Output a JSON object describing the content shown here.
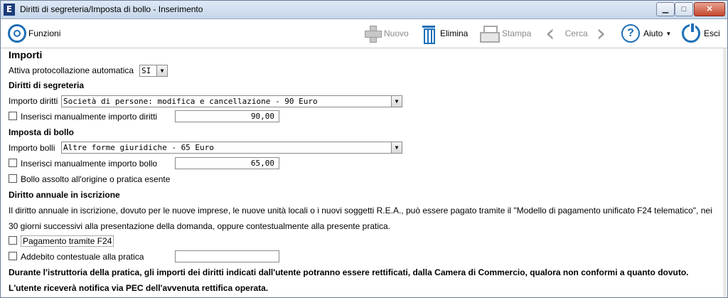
{
  "window": {
    "title": "Diritti di segreteria/Imposta di bollo - Inserimento",
    "app_icon_letter": "E",
    "min_glyph": "▁",
    "max_glyph": "□",
    "close_glyph": "✕"
  },
  "toolbar": {
    "funzioni": "Funzioni",
    "nuovo": "Nuovo",
    "elimina": "Elimina",
    "stampa": "Stampa",
    "prev_glyph": "‹",
    "cerca": "Cerca",
    "next_glyph": "›",
    "help_glyph": "?",
    "aiuto": "Aiuto",
    "caret": "▼",
    "esci": "Esci"
  },
  "form": {
    "section_title": "Importi",
    "protocollazione_label": "Attiva protocollazione automatica",
    "protocollazione_value": "SI",
    "segreteria_title": "Diritti di segreteria",
    "importo_diritti_label": "Importo diritti",
    "importo_diritti_value": "Società di persone: modifica e cancellazione - 90 Euro",
    "manuale_diritti_label": "Inserisci manualmente importo diritti",
    "manuale_diritti_value": "90,00",
    "bollo_title": "Imposta di bollo",
    "importo_bolli_label": "Importo bolli",
    "importo_bolli_value": "Altre forme giuridiche - 65 Euro",
    "manuale_bollo_label": "Inserisci manualmente importo bollo",
    "manuale_bollo_value": "65,00",
    "bollo_assolto_label": "Bollo assolto all'origine o pratica esente",
    "annuale_title": "Diritto annuale in iscrizione",
    "annuale_text_1": "Il diritto annuale in iscrizione, dovuto per le nuove imprese, le nuove unità locali o i nuovi soggetti R.E.A., può essere pagato tramite il \"Modello di pagamento unificato F24 telematico\",  nei",
    "annuale_text_2": "30 giorni successivi alla presentazione della domanda, oppure contestualmente alla presente pratica.",
    "f24_label": "Pagamento tramite F24",
    "addebito_label": "Addebito contestuale alla pratica",
    "addebito_value": "",
    "note_1": "Durante l'istruttoria della pratica, gli importi dei diritti indicati dall'utente potranno essere rettificati, dalla Camera di Commercio, qualora non conformi a quanto dovuto.",
    "note_2": "L'utente riceverà notifica via PEC dell'avvenuta rettifica operata."
  }
}
